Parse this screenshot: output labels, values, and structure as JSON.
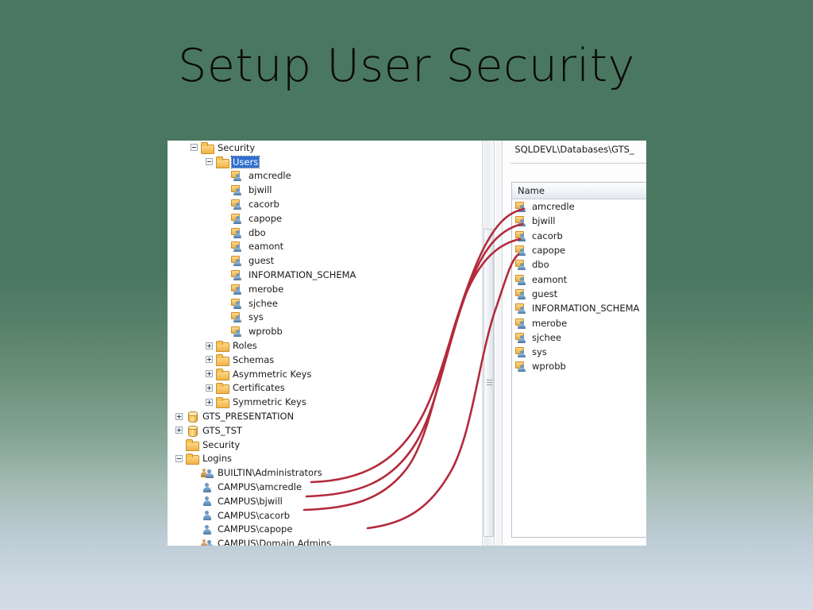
{
  "slide": {
    "title": "Setup User Security",
    "background_top": "#4a7760",
    "background_bottom": "#d4dce6",
    "annotation_color": "#b32a3c"
  },
  "tree": {
    "scrollbar": "vertical-scrollbar",
    "items": [
      {
        "label": "Security",
        "depth": 1,
        "expander": "minus",
        "icon": "folder"
      },
      {
        "label": "Users",
        "depth": 2,
        "expander": "minus",
        "icon": "folder",
        "selected": true
      },
      {
        "label": "amcredle",
        "depth": 3,
        "expander": "none",
        "icon": "dbuser"
      },
      {
        "label": "bjwill",
        "depth": 3,
        "expander": "none",
        "icon": "dbuser"
      },
      {
        "label": "cacorb",
        "depth": 3,
        "expander": "none",
        "icon": "dbuser"
      },
      {
        "label": "capope",
        "depth": 3,
        "expander": "none",
        "icon": "dbuser"
      },
      {
        "label": "dbo",
        "depth": 3,
        "expander": "none",
        "icon": "dbuser"
      },
      {
        "label": "eamont",
        "depth": 3,
        "expander": "none",
        "icon": "dbuser"
      },
      {
        "label": "guest",
        "depth": 3,
        "expander": "none",
        "icon": "dbuser"
      },
      {
        "label": "INFORMATION_SCHEMA",
        "depth": 3,
        "expander": "none",
        "icon": "dbuser"
      },
      {
        "label": "merobe",
        "depth": 3,
        "expander": "none",
        "icon": "dbuser"
      },
      {
        "label": "sjchee",
        "depth": 3,
        "expander": "none",
        "icon": "dbuser"
      },
      {
        "label": "sys",
        "depth": 3,
        "expander": "none",
        "icon": "dbuser"
      },
      {
        "label": "wprobb",
        "depth": 3,
        "expander": "none",
        "icon": "dbuser"
      },
      {
        "label": "Roles",
        "depth": 2,
        "expander": "plus",
        "icon": "folder"
      },
      {
        "label": "Schemas",
        "depth": 2,
        "expander": "plus",
        "icon": "folder"
      },
      {
        "label": "Asymmetric Keys",
        "depth": 2,
        "expander": "plus",
        "icon": "folder"
      },
      {
        "label": "Certificates",
        "depth": 2,
        "expander": "plus",
        "icon": "folder"
      },
      {
        "label": "Symmetric Keys",
        "depth": 2,
        "expander": "plus",
        "icon": "folder"
      },
      {
        "label": "GTS_PRESENTATION",
        "depth": 0,
        "expander": "plus",
        "icon": "db"
      },
      {
        "label": "GTS_TST",
        "depth": 0,
        "expander": "plus",
        "icon": "db"
      },
      {
        "label": "Security",
        "depth": 0,
        "expander": "none",
        "icon": "folder"
      },
      {
        "label": "Logins",
        "depth": 0,
        "expander": "minus",
        "icon": "folder"
      },
      {
        "label": "BUILTIN\\Administrators",
        "depth": 1,
        "expander": "none",
        "icon": "group"
      },
      {
        "label": "CAMPUS\\amcredle",
        "depth": 1,
        "expander": "none",
        "icon": "user"
      },
      {
        "label": "CAMPUS\\bjwill",
        "depth": 1,
        "expander": "none",
        "icon": "user"
      },
      {
        "label": "CAMPUS\\cacorb",
        "depth": 1,
        "expander": "none",
        "icon": "user"
      },
      {
        "label": "CAMPUS\\capope",
        "depth": 1,
        "expander": "none",
        "icon": "user"
      },
      {
        "label": "CAMPUS\\Domain Admins",
        "depth": 1,
        "expander": "none",
        "icon": "group"
      }
    ]
  },
  "detail": {
    "path": "SQLDEVL\\Databases\\GTS_",
    "column_header": "Name",
    "rows": [
      {
        "label": "amcredle",
        "icon": "dbuser"
      },
      {
        "label": "bjwill",
        "icon": "dbuser"
      },
      {
        "label": "cacorb",
        "icon": "dbuser"
      },
      {
        "label": "capope",
        "icon": "dbuser"
      },
      {
        "label": "dbo",
        "icon": "dbuser"
      },
      {
        "label": "eamont",
        "icon": "dbuser"
      },
      {
        "label": "guest",
        "icon": "dbuser"
      },
      {
        "label": "INFORMATION_SCHEMA",
        "icon": "dbuser"
      },
      {
        "label": "merobe",
        "icon": "dbuser"
      },
      {
        "label": "sjchee",
        "icon": "dbuser"
      },
      {
        "label": "sys",
        "icon": "dbuser"
      },
      {
        "label": "wprobb",
        "icon": "dbuser"
      }
    ]
  },
  "annotations": {
    "description": "Four hand-drawn red curves linking server logins to database users",
    "curves": [
      {
        "from": "CAMPUS\\amcredle",
        "to": "amcredle"
      },
      {
        "from": "CAMPUS\\bjwill",
        "to": "bjwill"
      },
      {
        "from": "CAMPUS\\cacorb",
        "to": "cacorb"
      },
      {
        "from": "CAMPUS\\capope",
        "to": "capope"
      }
    ]
  }
}
